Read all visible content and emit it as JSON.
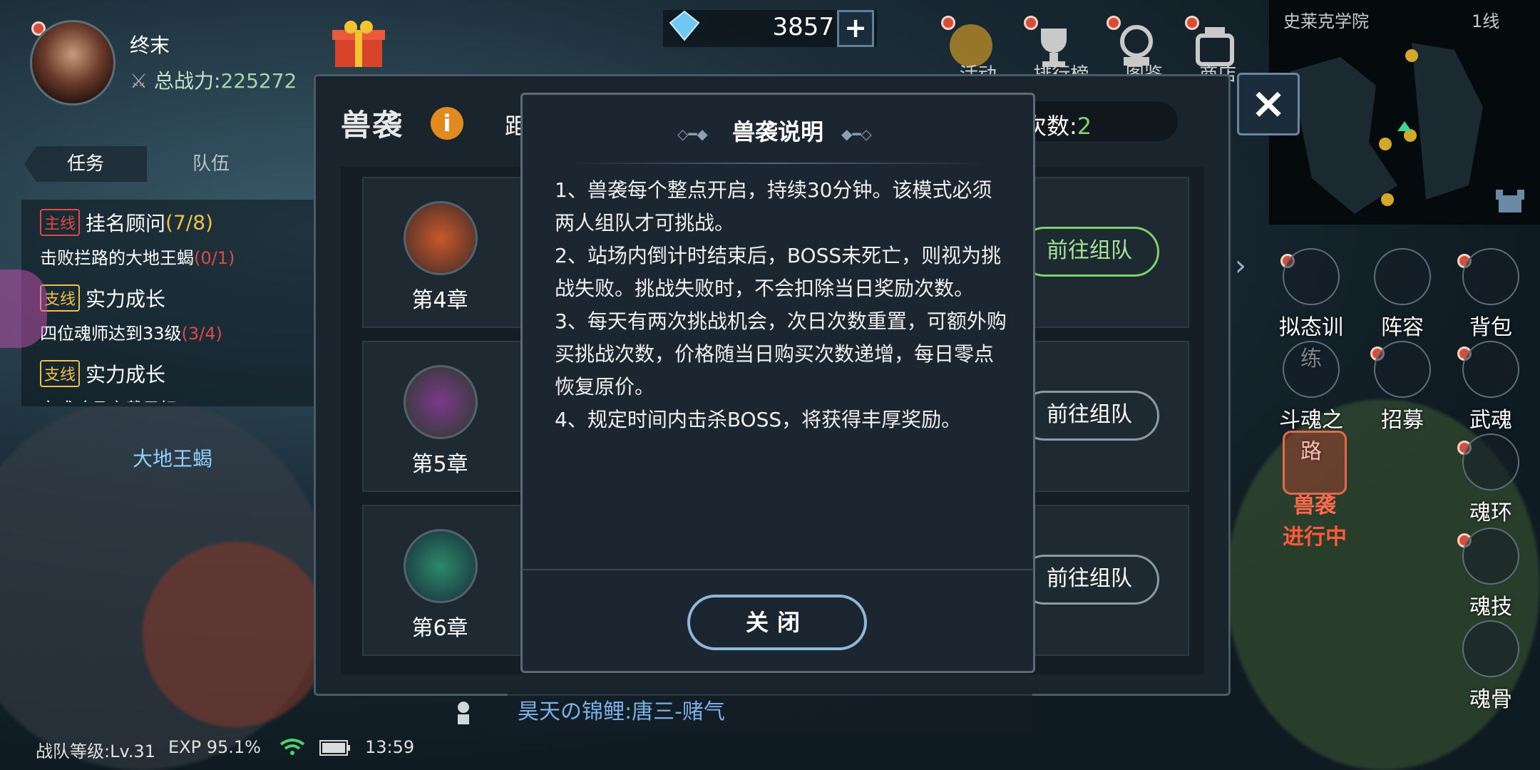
{
  "player": {
    "name": "终末",
    "power_label": "总战力:",
    "power_value": "225272"
  },
  "currency": {
    "diamond_value": "3857",
    "add_icon": "+"
  },
  "top_icons": [
    "gift-icon",
    "activity-icon",
    "ranking-icon",
    "handbook-icon",
    "shop-icon"
  ],
  "top_icon_labels": [
    "活动",
    "排行榜",
    "图鉴",
    "商店"
  ],
  "minimap": {
    "location": "史莱克学院",
    "line": "1线"
  },
  "close_icon": "×",
  "quest_panel": {
    "tabs": [
      "任务",
      "队伍"
    ],
    "quests": [
      {
        "tag": "主线",
        "title": "挂名顾问",
        "progress": "(7/8)",
        "desc": "击败拦路的大地王蝎",
        "desc_progress": "(0/1)"
      },
      {
        "tag": "支线",
        "title": "实力成长",
        "desc": "四位魂师达到33级",
        "desc_progress": "(3/4)"
      },
      {
        "tag": "支线",
        "title": "实力成长",
        "desc": "完成魂骨穿戴目标"
      }
    ],
    "boss_label": "大地王蝎"
  },
  "status_bar": {
    "team_level": "战队等级:Lv.31",
    "exp": "EXP 95.1%",
    "time": "13:59"
  },
  "beast_panel": {
    "title": "兽袭",
    "info_icon": "i",
    "road_text": "距",
    "remain_label": "次数:",
    "remain_value": "2",
    "chapters": [
      {
        "label": "第4章",
        "button": "前往组队",
        "active": true
      },
      {
        "label": "第5章",
        "button": "前往组队",
        "active": false
      },
      {
        "label": "第6章",
        "button": "前往组队",
        "active": false
      }
    ]
  },
  "modal": {
    "title": "兽袭说明",
    "lines": [
      "1、兽袭每个整点开启，持续30分钟。该模式必须两人组队才可挑战。",
      "2、站场内倒计时结束后，BOSS未死亡，则视为挑战失败。挑战失败时，不会扣除当日奖励次数。",
      "3、每天有两次挑战机会，次日次数重置，可额外购买挑战次数，价格随当日购买次数递增，每日零点恢复原价。",
      "4、规定时间内击杀BOSS，将获得丰厚奖励。"
    ],
    "close_button": "关闭"
  },
  "chat": {
    "text": "昊天の锦鲤:唐三-赌气"
  },
  "right_menu": [
    {
      "label": "拟态训练",
      "icon": "mimic-training-icon"
    },
    {
      "label": "阵容",
      "icon": "lineup-icon"
    },
    {
      "label": "背包",
      "icon": "backpack-icon"
    },
    {
      "label": "斗魂之路",
      "icon": "soul-road-icon"
    },
    {
      "label": "招募",
      "icon": "recruit-icon"
    },
    {
      "label": "武魂",
      "icon": "martial-soul-icon"
    },
    {
      "label": "魂环",
      "icon": "soul-ring-icon"
    },
    {
      "label": "魂技",
      "icon": "soul-skill-icon"
    },
    {
      "label": "魂骨",
      "icon": "soul-bone-icon"
    }
  ],
  "beast_mode": {
    "label": "兽袭",
    "status": "进行中"
  },
  "colors": {
    "accent_green": "#7fd36a",
    "danger_red": "#e04848",
    "beast_orange": "#ff5a3a",
    "info_orange": "#e08a20"
  }
}
